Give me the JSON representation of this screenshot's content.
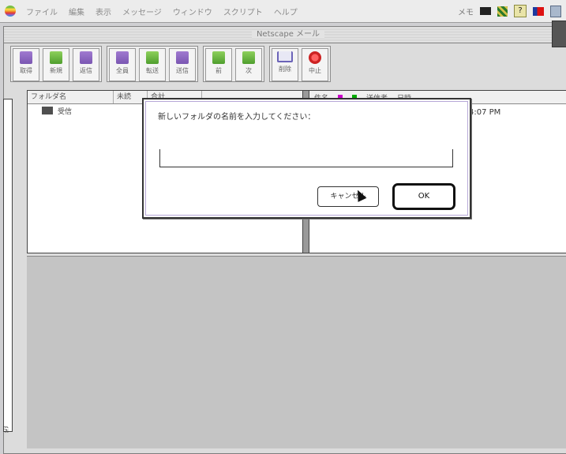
{
  "menubar": {
    "items": [
      "ファイル",
      "編集",
      "表示",
      "メッセージ",
      "ウィンドウ",
      "スクリプト",
      "ヘルプ"
    ],
    "right_text": "メモ"
  },
  "window": {
    "title": "Netscape メール"
  },
  "toolbar": {
    "buttons": [
      {
        "label": "取得",
        "icon": "get-mail-icon"
      },
      {
        "label": "新規",
        "icon": "new-message-icon"
      },
      {
        "label": "返信",
        "icon": "reply-icon"
      },
      {
        "label": "全員",
        "icon": "reply-all-icon"
      },
      {
        "label": "転送",
        "icon": "forward-icon"
      },
      {
        "label": "送信",
        "icon": "send-icon"
      },
      {
        "label": "前",
        "icon": "previous-icon"
      },
      {
        "label": "次",
        "icon": "next-icon"
      },
      {
        "label": "削除",
        "icon": "trash-icon"
      },
      {
        "label": "中止",
        "icon": "stop-icon"
      }
    ]
  },
  "list": {
    "headers": [
      "フォルダ名",
      "未読",
      "合計"
    ],
    "rows": [
      {
        "name": "受信"
      }
    ]
  },
  "messages": {
    "headers": [
      "件名",
      "送信者",
      "日時"
    ],
    "time": "4:07 PM"
  },
  "dialog": {
    "message": "新しいフォルダの名前を入力してください：",
    "input_value": "",
    "cancel_label": "キャンセル",
    "ok_label": "OK"
  }
}
